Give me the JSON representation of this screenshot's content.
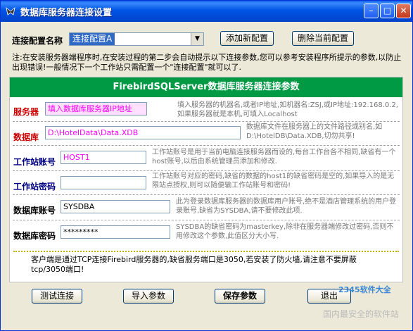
{
  "window": {
    "title": "数据库服务器连接设置"
  },
  "config": {
    "label": "连接配置名称",
    "selected": "连接配置A",
    "add_button": "添加新配置",
    "delete_button": "删除当前配置"
  },
  "note": "注:在安装服务器端程序时,在安装过程的第二步会自动提示以下连接参数,您可以参考安装程序所提示的参数,以防止出现错误!一般情况下一个工作站只需配置一个\"连接配置\"就可以了.",
  "panel": {
    "title": "FirebirdSQLServer数据库服务器连接参数"
  },
  "fields": {
    "server": {
      "label": "服务器",
      "value": "填入数据库服务器IP地址",
      "desc": "填入服务器的机器名,或者IP地址,如机器名:ZSJ,或IP地址:192.168.0.2,如果服务器就是本机,可填入Localhost"
    },
    "database": {
      "label": "数据库",
      "value": "D:\\HotelData\\Data.XDB",
      "desc": "数据库文件在服务器上的文件路径或别名,如D:\\HotelDB\\Data.XDB,切勿共享!"
    },
    "ws_account": {
      "label": "工作站账号",
      "value": "HOST1",
      "desc": "工作站账号是用于当前电脑连接服务器而设的,每台工作台各不相同,缺省有一个host账号,以后由系统管理员添加和修改."
    },
    "ws_password": {
      "label": "工作站密码",
      "value": "",
      "desc": "工作站账号对应的密码,缺省的数据的host1的缺省密码是空的,如果导入的是无限站点授权,则可以随便输工作站账号和密码!"
    },
    "db_account": {
      "label": "数据库账号",
      "value": "SYSDBA",
      "desc": "此为登录数据库服务器的数据库用户账号,绝不是酒店管理系统的用户登录账号,缺省为SYSDBA,请不要修改此项."
    },
    "db_password": {
      "label": "数据库密码",
      "value": "*********",
      "desc": "SYSDBA的缺省密码为masterkey,除非在服务器端修改过密码,否则不用修改这个参数,此值区分大小写."
    }
  },
  "footer_note": "客户端是通过TCP连接Firebird服务器的,缺省服务端口是3050,若安装了防火墙,请注意不要屏蔽tcp/3050端口!",
  "buttons": {
    "test": "测试连接",
    "import": "导入参数",
    "save": "保存参数",
    "exit": "退出"
  },
  "watermark": {
    "brand": "2345软件大全",
    "slogan": "国内最安全的软件站"
  },
  "colors": {
    "panel_header": "#009944",
    "titlebar": "#0055e5"
  }
}
